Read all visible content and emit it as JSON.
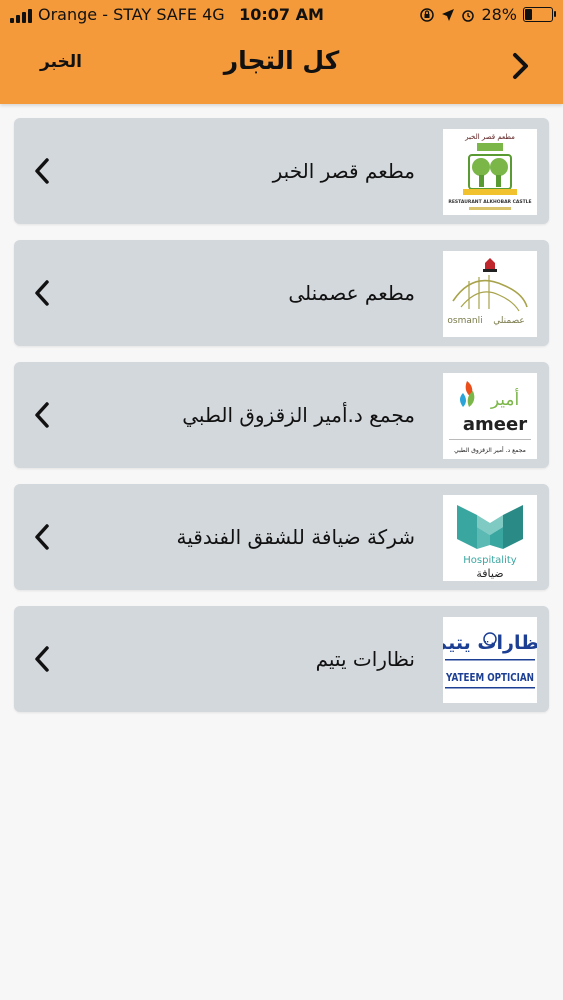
{
  "status_bar": {
    "carrier": "Orange - STAY SAFE  4G",
    "time": "10:07 AM",
    "battery": "28%",
    "battery_level": 0.28
  },
  "nav": {
    "title": "كل التجار",
    "left_label": "الخبر"
  },
  "merchants": [
    {
      "name": "مطعم قصر الخبر",
      "logo_icon": "qasr-alkhobar-restaurant-logo",
      "logo_text": "مطعم قصر الخبر",
      "logo_sub": "RESTAURANT ALKHOBAR CASTLE"
    },
    {
      "name": "مطعم عصمنلى",
      "logo_icon": "osmanli-restaurant-logo",
      "logo_text": "osmanli",
      "logo_sub": "عصمنلي"
    },
    {
      "name": "مجمع د.أمير الزقزوق الطبي",
      "logo_icon": "ameer-medical-logo",
      "logo_text": "ameer",
      "logo_ar": "أمير",
      "logo_sub": "مجمع د. أمير الزقزوق الطبي"
    },
    {
      "name": "شركة ضيافة للشقق الفندقية",
      "logo_icon": "hospitality-logo",
      "logo_text": "Hospitality",
      "logo_sub": "ضيافة"
    },
    {
      "name": "نظارات يتيم",
      "logo_icon": "yateem-optician-logo",
      "logo_text": "YATEEM OPTICIAN",
      "logo_ar": "نظارات يتيم"
    }
  ]
}
